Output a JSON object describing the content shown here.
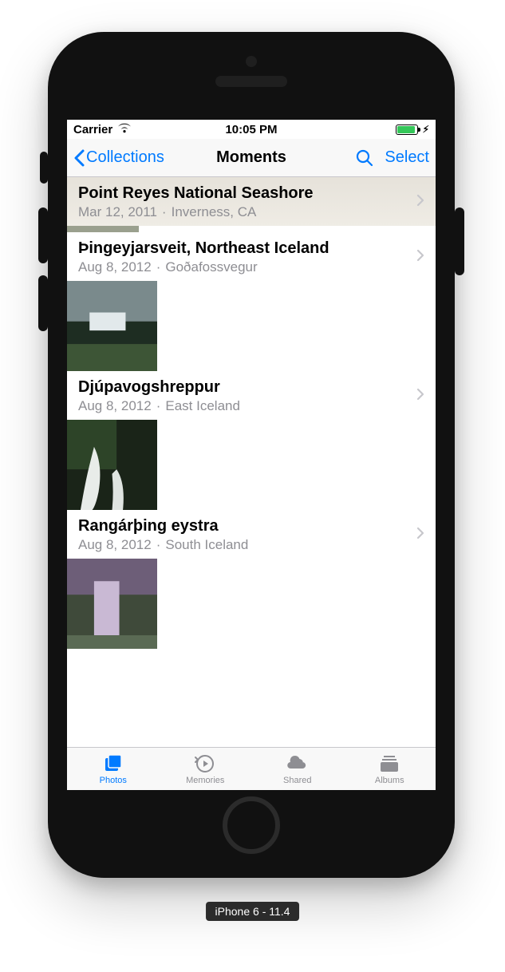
{
  "status": {
    "carrier": "Carrier",
    "time": "10:05 PM"
  },
  "nav": {
    "back": "Collections",
    "title": "Moments",
    "select": "Select"
  },
  "moments": [
    {
      "title": "Point Reyes National Seashore",
      "date": "Mar 12, 2011",
      "location": "Inverness, CA"
    },
    {
      "title": "Þingeyjarsveit, Northeast Iceland",
      "date": "Aug 8, 2012",
      "location": "Goðafossvegur"
    },
    {
      "title": "Djúpavogshreppur",
      "date": "Aug 8, 2012",
      "location": "East Iceland"
    },
    {
      "title": "Rangárþing eystra",
      "date": "Aug 8, 2012",
      "location": "South Iceland"
    }
  ],
  "tabs": {
    "photos": "Photos",
    "memories": "Memories",
    "shared": "Shared",
    "albums": "Albums"
  },
  "device_label": "iPhone 6 - 11.4",
  "colors": {
    "tint": "#007aff",
    "gray": "#8e8e93"
  }
}
